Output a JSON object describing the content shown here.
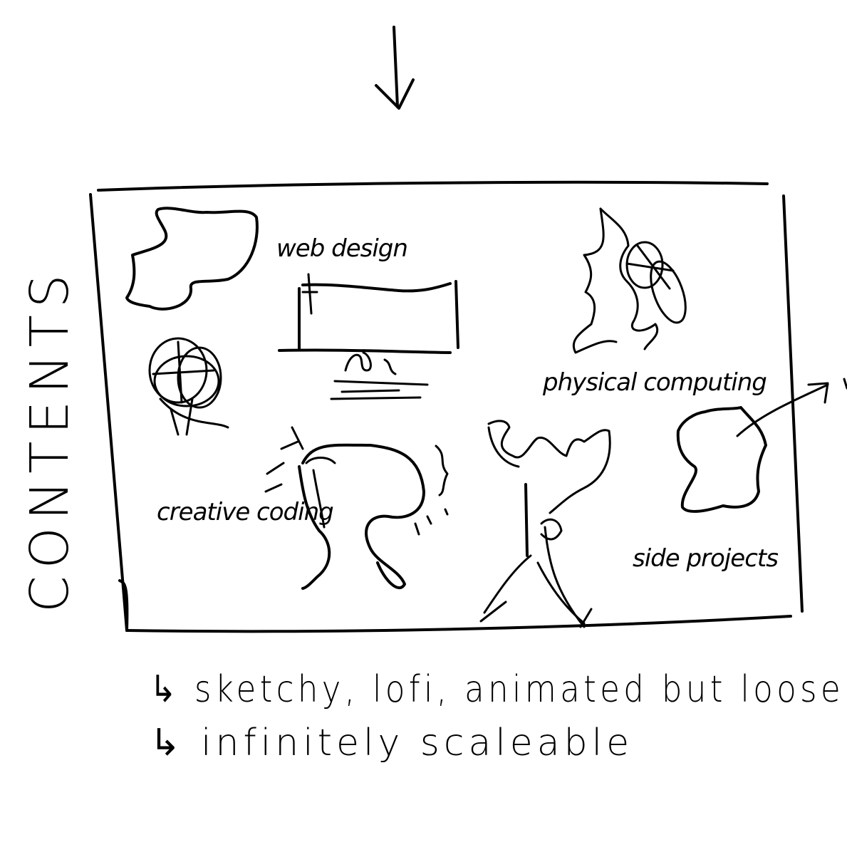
{
  "side_label": "CONTENTS",
  "labels": {
    "web_design": "web design",
    "physical_computing": "physical computing",
    "creative_coding": "creative coding",
    "side_projects": "side projects"
  },
  "notes": [
    "↳ sketchy, lofi, animated but loose",
    "↳ infinitely scaleable"
  ],
  "icons": {
    "arrow": "arrow-down-icon",
    "blob": "blob-icon",
    "scribble": "scribble-icon",
    "monitor": "monitor-icon",
    "plant": "plant-icon",
    "headphones": "headphones-icon",
    "figure": "figure-icon",
    "pointer_arrow": "pointer-arrow-icon"
  }
}
